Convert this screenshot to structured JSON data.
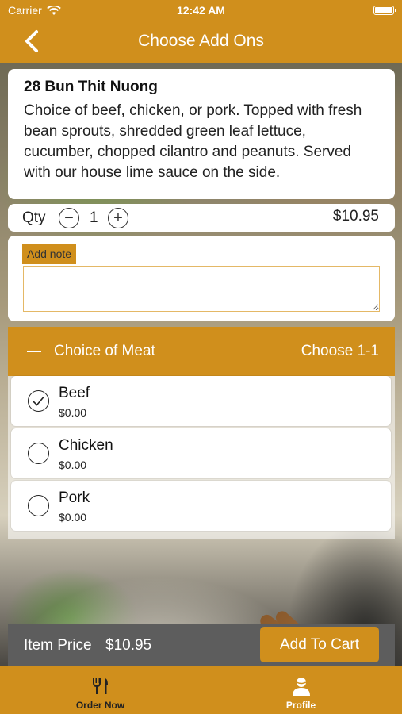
{
  "status": {
    "carrier": "Carrier",
    "time": "12:42 AM"
  },
  "header": {
    "title": "Choose Add Ons",
    "back_icon": "chevron-left-icon"
  },
  "item": {
    "title": "28 Bun Thit Nuong",
    "description": "Choice of beef, chicken, or pork. Topped with fresh bean sprouts, shredded green leaf lettuce, cucumber, chopped cilantro and peanuts. Served with our house lime sauce on the side."
  },
  "quantity": {
    "label": "Qty",
    "value": "1",
    "price": "$10.95",
    "minus": "−",
    "plus": "+"
  },
  "note": {
    "label": "Add note",
    "value": "",
    "placeholder": ""
  },
  "section": {
    "title": "Choice of Meat",
    "choose": "Choose 1-1",
    "options": [
      {
        "name": "Beef",
        "price": "$0.00",
        "selected": true
      },
      {
        "name": "Chicken",
        "price": "$0.00",
        "selected": false
      },
      {
        "name": "Pork",
        "price": "$0.00",
        "selected": false
      }
    ]
  },
  "footer": {
    "item_price_label": "Item Price",
    "item_price_value": "$10.95",
    "add_to_cart": "Add To Cart"
  },
  "tabs": [
    {
      "label": "Order Now",
      "icon": "utensils-icon"
    },
    {
      "label": "Profile",
      "icon": "user-icon"
    }
  ],
  "colors": {
    "accent": "#d08f1c",
    "footer_bar": "#5d5d5d"
  }
}
